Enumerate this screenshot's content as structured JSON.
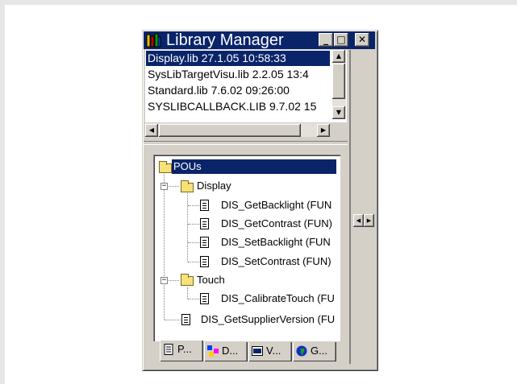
{
  "window": {
    "title": "Library Manager",
    "controls": {
      "minimize": "_",
      "maximize": "□",
      "close": "✕"
    }
  },
  "libraries": [
    {
      "label": "Display.lib 27.1.05 10:58:33",
      "selected": true
    },
    {
      "label": "SysLibTargetVisu.lib 2.2.05 13:4",
      "selected": false
    },
    {
      "label": "Standard.lib 7.6.02 09:26:00",
      "selected": false
    },
    {
      "label": "SYSLIBCALLBACK.LIB 9.7.02 15",
      "selected": false
    }
  ],
  "tree": {
    "root": "POUs",
    "display": "Display",
    "display_items": [
      "DIS_GetBacklight (FUN",
      "DIS_GetContrast (FUN)",
      "DIS_SetBacklight (FUN",
      "DIS_SetContrast (FUN)"
    ],
    "touch": "Touch",
    "touch_items": [
      "DIS_CalibrateTouch (FU"
    ],
    "root_items": [
      "DIS_GetSupplierVersion (FU"
    ]
  },
  "tabs": [
    "P...",
    "D...",
    "V...",
    "G..."
  ],
  "icons": {
    "app": "library-books-icon",
    "tab_icons": [
      "document-icon",
      "datatype-icon",
      "visualization-icon",
      "globe-icon"
    ]
  },
  "colors": {
    "selection": "#0a246a",
    "face": "#d4d0c8",
    "folder": "#f7e27a"
  }
}
